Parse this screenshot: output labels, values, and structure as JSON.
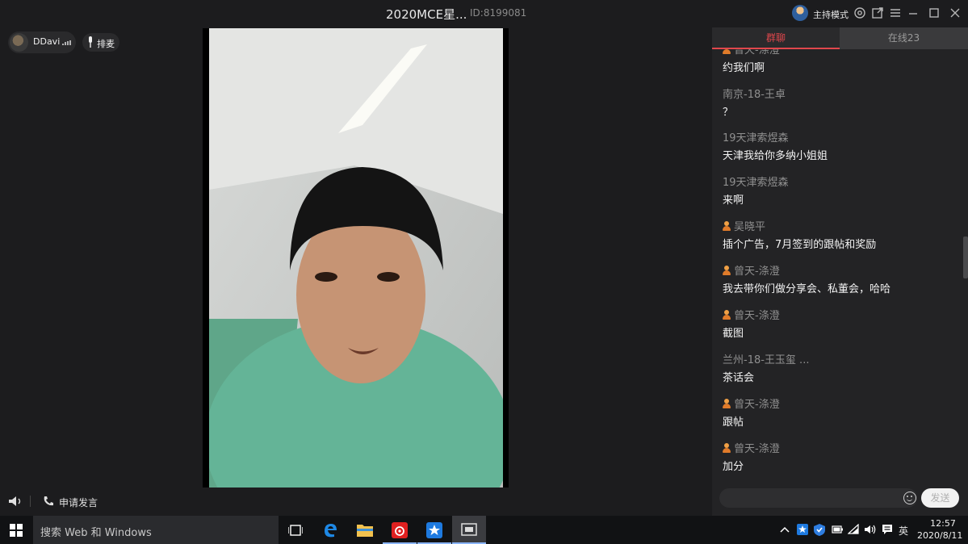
{
  "titlebar": {
    "title": "2020MCE星...",
    "room_id": "ID:8199081",
    "host_mode": "主持模式"
  },
  "stage": {
    "user_name": "DDavi",
    "user_flag_icon": "signal-icon",
    "queue_label": "排麦",
    "apply_speak": "申请发言"
  },
  "chat": {
    "tab_group": "群聊",
    "tab_online": "在线23",
    "messages": [
      {
        "name": "曾天-涤澄",
        "text": "约我们啊",
        "badge": true
      },
      {
        "name": "南京-18-王卓",
        "text": "？",
        "badge": false
      },
      {
        "name": "19天津索煜森",
        "text": "天津我给你多纳小姐姐",
        "badge": false
      },
      {
        "name": "19天津索煜森",
        "text": "来啊",
        "badge": false
      },
      {
        "name": "吴晓平",
        "text": "插个广告，7月签到的跟帖和奖励",
        "badge": true
      },
      {
        "name": "曾天-涤澄",
        "text": "我去带你们做分享会、私董会，哈哈",
        "badge": true
      },
      {
        "name": "曾天-涤澄",
        "text": "截图",
        "badge": true
      },
      {
        "name": "兰州-18-王玉玺      ...",
        "text": "茶话会",
        "badge": false
      },
      {
        "name": "曾天-涤澄",
        "text": "跟帖",
        "badge": true
      },
      {
        "name": "曾天-涤澄",
        "text": "加分",
        "badge": true
      }
    ],
    "send_label": "发送"
  },
  "taskbar": {
    "search_placeholder": "搜索 Web 和 Windows",
    "ime": "英",
    "time": "12:57",
    "date": "2020/8/11"
  },
  "colors": {
    "accent": "#e0474c",
    "background": "#1c1c1e",
    "panel": "#232325",
    "badge": "#e07b2a"
  }
}
